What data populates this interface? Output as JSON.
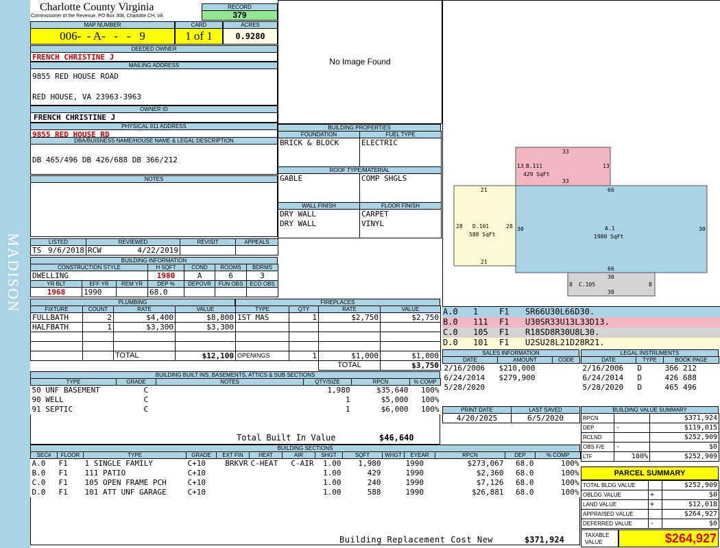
{
  "county": {
    "name": "Charlotte County Virginia",
    "address": "Commissioner of the Revenue, PO Box 308, Charlotte CH, VA"
  },
  "side_label": "MADISON",
  "record": {
    "label": "RECORD",
    "value": "379"
  },
  "map_number": {
    "label": "MAP NUMBER",
    "value": "006-  - A-   -   -   9"
  },
  "card": {
    "label": "CARD",
    "value": "1 of 1"
  },
  "acres": {
    "label": "ACRES",
    "value": "0.9280"
  },
  "deeded_owner": {
    "label": "DEEDED OWNER",
    "value": "FRENCH CHRISTINE J"
  },
  "mailing_address": {
    "label": "MAILING ADDRESS",
    "line1": "9855 RED HOUSE ROAD",
    "line2": "RED HOUSE, VA 23963-3963"
  },
  "owner_id": {
    "label": "OWNER ID",
    "value": "FRENCH CHRISTINE J"
  },
  "physical_address": {
    "label": "PHYSICAL 911 ADDRESS",
    "value": "9855 RED HOUSE RD"
  },
  "dba": {
    "label": "DBA/BUISNESS NAME/HOUSE NAME & LEGAL DESCRIPTION",
    "value": "DB 465/496 DB 426/688 DB 366/212"
  },
  "notes": {
    "label": "NOTES"
  },
  "photo": {
    "text": "No Image Found"
  },
  "review": {
    "listed_label": "LISTED",
    "reviewed_label": "REVIEWED",
    "revisit_label": "REVISIT",
    "appeals_label": "APPEALS",
    "listed_by": "TS",
    "listed_date": "9/6/2018",
    "reviewed_by": "RCW",
    "reviewed_date": "4/22/2019"
  },
  "building_info": {
    "label": "BUILDING INFORMATION",
    "h_construction": "CONSTRUCTION STYLE",
    "h_hsqft": "H SQFT",
    "h_cond": "COND",
    "h_rooms": "ROOMS",
    "h_bdrms": "BDRMS",
    "construction": "DWELLING",
    "hsqft": "1980",
    "cond": "A",
    "rooms": "6",
    "bdrms": "3",
    "h_yrblt": "YR BLT",
    "h_effyr": "EFF YR",
    "h_remyr": "REM YR",
    "h_dep": "DEP %",
    "h_depovr": "DEPOVR",
    "h_funobs": "FUN OBS",
    "h_ecoobs": "ECO OBS",
    "yrblt": "1968",
    "effyr": "1990",
    "dep": "68.0"
  },
  "building_props": {
    "label": "BUILDING PROPERTIES",
    "h_foundation": "FOUNDATION",
    "h_fuel": "FUEL TYPE",
    "foundation": "BRICK & BLOCK",
    "fuel": "ELECTRIC",
    "h_roof": "ROOF TYPE/MATERIAL",
    "roof_type": "GABLE",
    "roof_mat": "COMP SHGLS",
    "h_wall": "WALL FINISH",
    "h_floor": "FLOOR FINISH",
    "wall1": "DRY WALL",
    "wall2": "DRY WALL",
    "floor1": "CARPET",
    "floor2": "VINYL"
  },
  "plumbing": {
    "label": "PLUMBING",
    "headers": [
      "FIXTURE",
      "COUNT",
      "RATE",
      "VALUE"
    ],
    "rows": [
      [
        "FULLBATH",
        "2",
        "$4,400",
        "$8,800"
      ],
      [
        "HALFBATH",
        "1",
        "$3,300",
        "$3,300"
      ]
    ],
    "total_label": "TOTAL",
    "total": "$12,100"
  },
  "fireplaces": {
    "label": "FIREPLACES",
    "headers": [
      "TYPE",
      "QTY",
      "RATE",
      "VALUE"
    ],
    "rows": [
      [
        "1ST MAS",
        "1",
        "$2,750",
        "$2,750"
      ]
    ],
    "openings_label": "OPENINGS",
    "openings_qty": "1",
    "openings_rate": "$1,000",
    "openings_value": "$1,000",
    "total_label": "TOTAL",
    "total": "$3,750"
  },
  "sketch": {
    "labels": {
      "a_name": "A.1",
      "a_area": "1980 SqFt",
      "a_top": "66",
      "a_bottom": "66",
      "a_left": "30",
      "a_right": "30",
      "b_name": "B.111",
      "b_area": "429 SqFt",
      "b_top": "33",
      "b_bottom": "33",
      "b_left": "13",
      "b_right": "13",
      "c_name": "C.105",
      "c_top": "30",
      "c_bottom": "30",
      "c_left": "8",
      "c_right": "8",
      "d_name": "D.101",
      "d_area": "588 SqFt",
      "d_top": "21",
      "d_bottom": "21",
      "d_left": "28",
      "d_right": "28"
    },
    "colors": {
      "a": "#a9d4e3",
      "b": "#f4b6c2",
      "c": "#d3d3d3",
      "d": "#fffbd5"
    }
  },
  "sketch_codes": [
    {
      "id": "A.0",
      "n": "1",
      "f": "F1",
      "code": "SR66U30L66D30.",
      "color": "#a9d4e3"
    },
    {
      "id": "B.0",
      "n": "111",
      "f": "F1",
      "code": "U30SR33U13L33D13.",
      "color": "#f4b6c2"
    },
    {
      "id": "C.0",
      "n": "105",
      "f": "F1",
      "code": "R18SD8R30U8L30.",
      "color": "#d3d3d3"
    },
    {
      "id": "D.0",
      "n": "101",
      "f": "F1",
      "code": "U2SU28L21D28R21.",
      "color": "#fffbd5"
    }
  ],
  "sales": {
    "label": "SALES INFORMATION",
    "headers": [
      "DATE",
      "AMOUNT",
      "CODE"
    ],
    "rows": [
      [
        "2/16/2006",
        "$210,000",
        ""
      ],
      [
        "6/24/2014",
        "$279,900",
        ""
      ],
      [
        "5/28/2020",
        "",
        ""
      ]
    ]
  },
  "legal": {
    "label": "LEGAL INSTRUMENTS",
    "headers": [
      "DATE",
      "TYPE",
      "BOOK PAGE"
    ],
    "rows": [
      [
        "2/16/2006",
        "D",
        "366 212"
      ],
      [
        "6/24/2014",
        "D",
        "426 688"
      ],
      [
        "5/28/2020",
        "D",
        "465 496"
      ]
    ]
  },
  "print_info": {
    "h_print": "PRINT DATE",
    "h_saved": "LAST SAVED",
    "print_date": "4/20/2025",
    "last_saved": "6/5/2020"
  },
  "value_summary": {
    "label": "BUILDING VALUE SUMMARY",
    "rows": [
      {
        "label": "RPCN",
        "sign": "",
        "value": "$371,924"
      },
      {
        "label": "DEP",
        "sign": "-",
        "value": "$119,015"
      },
      {
        "label": "RCLND",
        "sign": "",
        "value": "$252,909"
      },
      {
        "label": "OBS F/E",
        "sign": "-",
        "value": "$0"
      },
      {
        "label": "LTF",
        "pct": "100%",
        "sign": "",
        "value": "$252,909"
      }
    ]
  },
  "parcel_summary": {
    "label": "PARCEL SUMMARY",
    "rows": [
      {
        "label": "TOTAL BLDG VALUE",
        "sign": "",
        "value": "$252,909"
      },
      {
        "label": "OBLDG VALUE",
        "sign": "+",
        "value": "$0"
      },
      {
        "label": "LAND VALUE",
        "sign": "+",
        "value": "$12,018"
      },
      {
        "label": "APPRAISED VALUE",
        "sign": "",
        "value": "$264,927"
      },
      {
        "label": "DEFERRED VALUE",
        "sign": "-",
        "value": "$0"
      }
    ],
    "taxable_label": "TAXABLE VALUE",
    "taxable_value": "$264,927"
  },
  "built_ins": {
    "label": "BUILDING BUILT INS, BASEMENTS, ATTICS & SUB SECTIONS",
    "headers": [
      "TYPE",
      "GRADE",
      "NOTES",
      "QTY/SIZE",
      "RPCN",
      "% COMP"
    ],
    "rows": [
      [
        "50 UNF BASEMENT",
        "C",
        "",
        "1,980",
        "$35,640",
        "100%"
      ],
      [
        "90 WELL",
        "C",
        "",
        "1",
        "$5,000",
        "100%"
      ],
      [
        "91 SEPTIC",
        "C",
        "",
        "1",
        "$6,000",
        "100%"
      ]
    ],
    "total_label": "Total Built In Value",
    "total": "$46,640"
  },
  "sections": {
    "label": "BUILDING SECTIONS",
    "headers": [
      "SEC#",
      "FLOOR",
      "TYPE",
      "GRADE",
      "EXT FIN",
      "HEAT",
      "AIR",
      "SHGT",
      "SQFT",
      "WHGT",
      "EYEAR",
      "RPCN",
      "DEP",
      "% COMP"
    ],
    "rows": [
      [
        "A.0",
        "F1",
        "1 SINGLE FAMILY",
        "C+10",
        "BRKVR",
        "C-HEAT",
        "C-AIR",
        "1.00",
        "1,980",
        "",
        "1990",
        "$273,067",
        "68.0",
        "100%"
      ],
      [
        "B.0",
        "F1",
        "111 PATIO",
        "C+10",
        "",
        "",
        "",
        "1.00",
        "429",
        "",
        "1990",
        "$2,360",
        "68.0",
        "100%"
      ],
      [
        "C.0",
        "F1",
        "105 OPEN FRAME PCH",
        "C+10",
        "",
        "",
        "",
        "1.00",
        "240",
        "",
        "1990",
        "$7,126",
        "68.0",
        "100%"
      ],
      [
        "D.0",
        "F1",
        "101 ATT UNF GARAGE",
        "C+10",
        "",
        "",
        "",
        "1.00",
        "588",
        "",
        "1990",
        "$26,881",
        "68.0",
        "100%"
      ]
    ],
    "replacement_label": "Building Replacement Cost New",
    "replacement_value": "$371,924"
  }
}
